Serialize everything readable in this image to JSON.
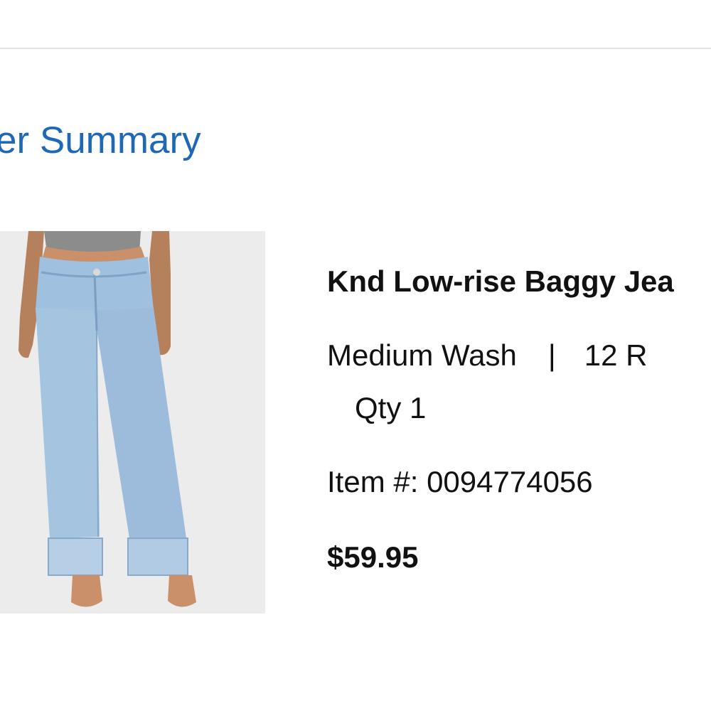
{
  "order_summary": {
    "title": "er Summary"
  },
  "item": {
    "name": "Knd Low-rise Baggy Jea",
    "color": "Medium Wash",
    "separator": "|",
    "size": "12 R",
    "qty_label": "Qty",
    "qty_value": "1",
    "item_number_label": "Item #:",
    "item_number": "0094774056",
    "price": "$59.95",
    "image_icon": "product-photo-jeans"
  },
  "colors": {
    "title_blue": "#1f68b5",
    "text": "#111111",
    "divider": "#e2e2e2",
    "denim": "#9fc0df"
  }
}
